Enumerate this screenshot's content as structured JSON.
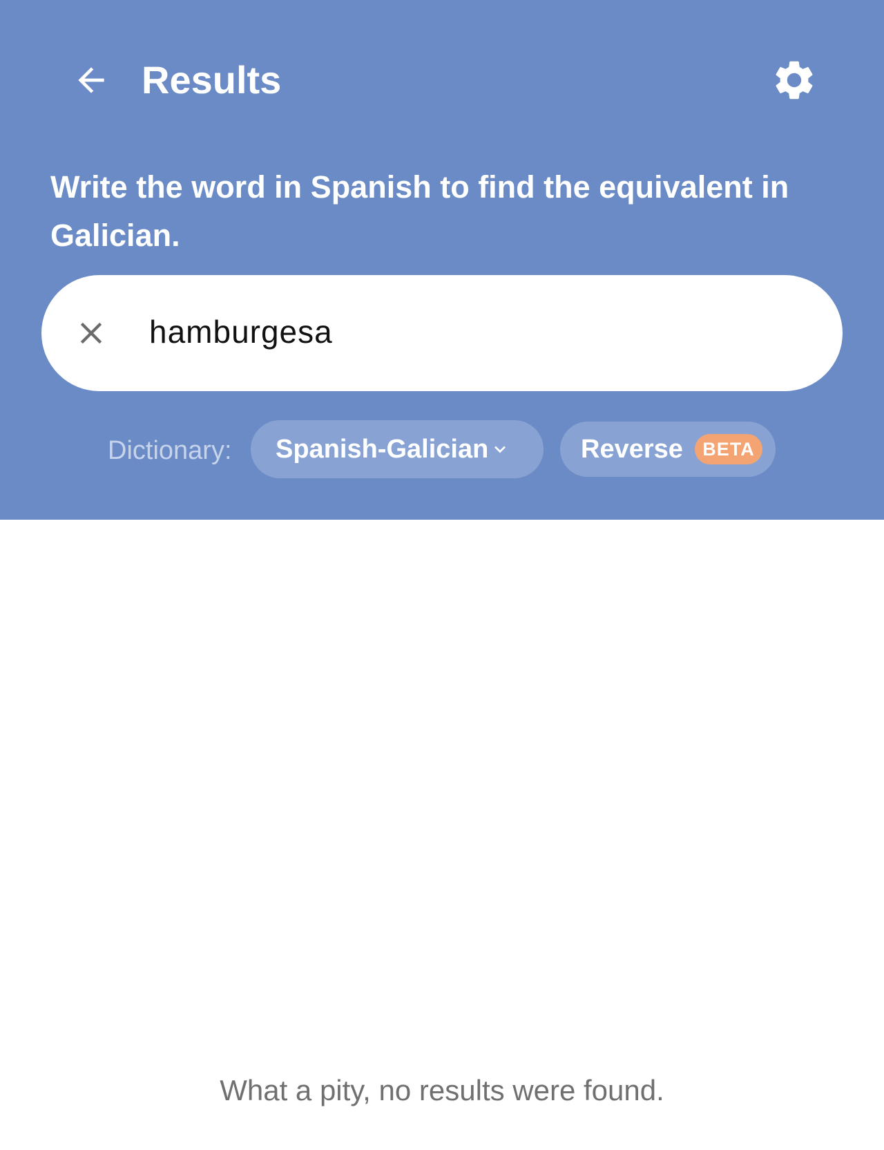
{
  "app_bar": {
    "title": "Results",
    "back_icon": "arrow-left-icon",
    "settings_icon": "gear-icon"
  },
  "instruction": "Write the word in Spanish to find the equivalent in Galician.",
  "search": {
    "value": "hamburgesa",
    "clear_icon": "close-icon"
  },
  "dictionary": {
    "label": "Dictionary:",
    "selected": "Spanish-Galician",
    "chevron_icon": "chevron-down-icon"
  },
  "reverse": {
    "label": "Reverse",
    "badge": "BETA"
  },
  "results": {
    "empty_message": "What a pity, no results were found."
  },
  "colors": {
    "header_background": "#6a8bc5",
    "chip_background": "#88a3d3",
    "beta_badge": "#f4a373",
    "empty_text": "#707070"
  }
}
